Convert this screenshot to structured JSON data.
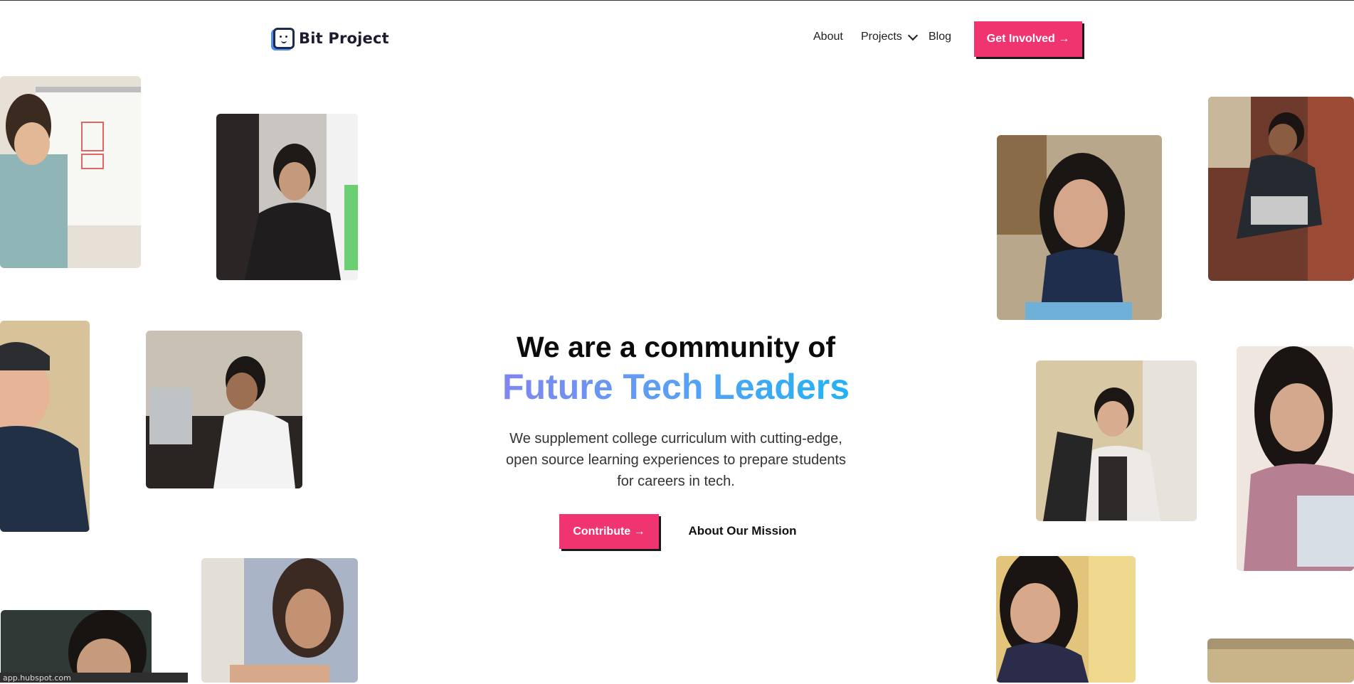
{
  "header": {
    "logo_text": "Bit Project",
    "nav": {
      "about": "About",
      "projects": "Projects",
      "blog": "Blog"
    },
    "cta": "Get Involved →"
  },
  "hero": {
    "title_line1": "We are a community of",
    "title_line2": "Future Tech Leaders",
    "subtitle": "We supplement college curriculum with cutting-edge, open source learning experiences to prepare students for careers in tech.",
    "primary_button": "Contribute →",
    "secondary_button": "About Our Mission"
  },
  "colors": {
    "accent": "#ef346f",
    "gradient_start": "#8a7ff0",
    "gradient_end": "#12b8f5"
  },
  "status_bar": "app.hubspot.com",
  "photos": [
    "student-whiteboard-photo",
    "student-notes-photo",
    "student-headphones-photo",
    "student-laptop-photo",
    "student-bottom-left-photo",
    "student-typing-photo",
    "student-stylus-photo",
    "student-desk-photo",
    "student-laptop-striped-photo",
    "student-pink-shirt-photo",
    "student-writing-photo",
    "student-bottom-right-photo"
  ]
}
